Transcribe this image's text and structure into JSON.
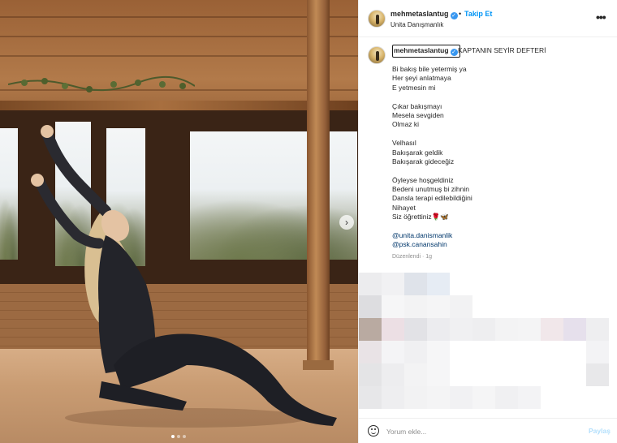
{
  "header": {
    "username": "mehmetaslantug",
    "follow_label": "Takip Et",
    "separator": "•",
    "subtitle": "Unita Danışmanlık",
    "more_label": "•••"
  },
  "caption": {
    "username": "mehmetaslantug",
    "title": "KAPTANIN SEYİR DEFTERİ",
    "lines": [
      "Bi bakış bile yetermiş ya",
      "Her şeyi anlatmaya",
      "E yetmesin mi",
      "",
      "Çıkar bakışmayı",
      "Mesela sevgiden",
      "Olmaz ki",
      "",
      "Velhasıl",
      "Bakışarak geldik",
      "Bakışarak gideceğiz",
      "",
      "Öyleyse hoşgeldiniz",
      "Bedeni unutmuş bi zihnin",
      "Dansla terapi edilebildiğini",
      "Nihayet",
      "Siz öğrettiniz🌹🦋",
      ""
    ],
    "mentions": [
      "@unita.danismanlik",
      "@psk.canansahin"
    ],
    "edited": "Düzenlendi · 1g"
  },
  "comment": {
    "placeholder": "Yorum ekle...",
    "share_label": "Paylaş"
  },
  "colors": {
    "link_blue": "#0095f6",
    "mention_blue": "#00376b",
    "verified_blue": "#3897f0",
    "muted_gray": "#8e8e8e"
  }
}
